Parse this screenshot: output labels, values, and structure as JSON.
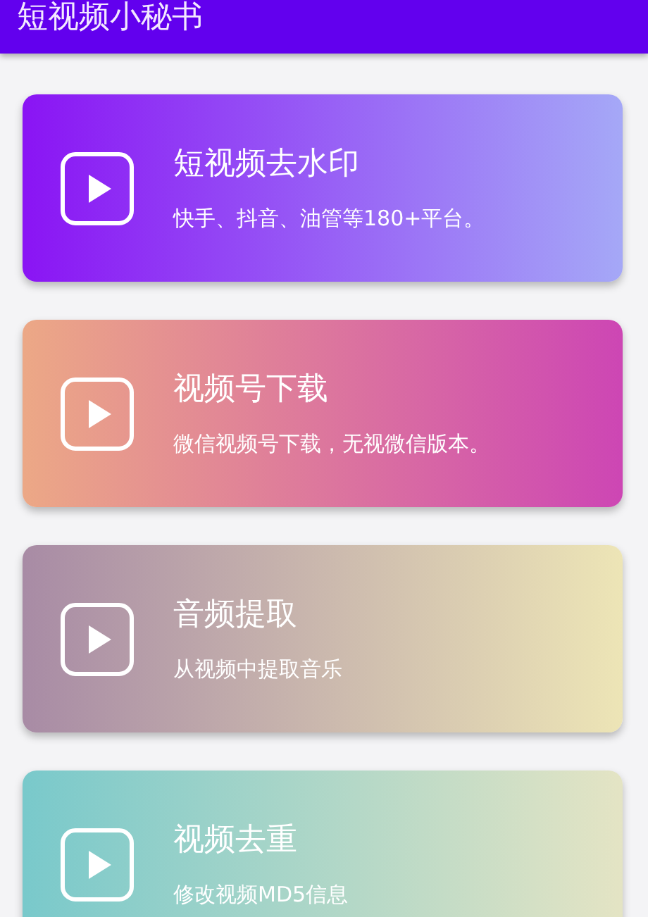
{
  "app_bar": {
    "title": "短视频小秘书"
  },
  "cards": [
    {
      "title": "短视频去水印",
      "subtitle": "快手、抖音、油管等180+平台。"
    },
    {
      "title": "视频号下载",
      "subtitle": "微信视频号下载，无视微信版本。"
    },
    {
      "title": "音频提取",
      "subtitle": "从视频中提取音乐"
    },
    {
      "title": "视频去重",
      "subtitle": "修改视频MD5信息"
    }
  ]
}
